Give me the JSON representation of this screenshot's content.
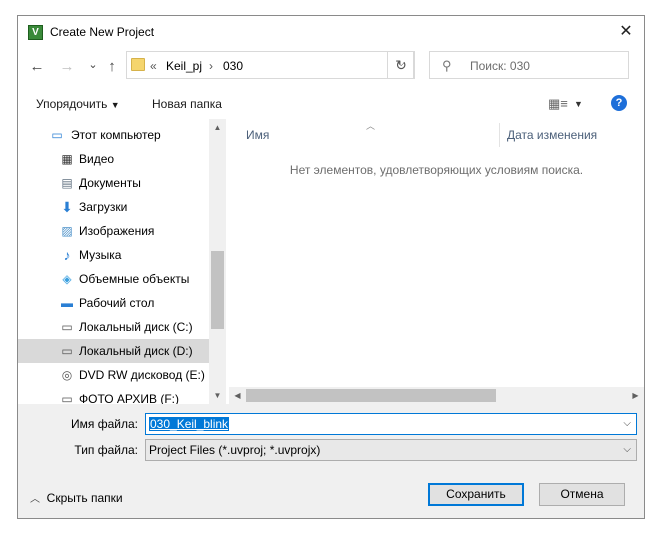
{
  "window": {
    "title": "Create New Project",
    "app_icon": "keil-uvision-icon"
  },
  "navigation": {
    "back_icon": "←",
    "forward_icon": "→",
    "recent_icon": "⌄",
    "up_icon": "↑",
    "address_prefix": "«",
    "path": [
      "Keil_pj",
      "030"
    ],
    "path_separator": "›",
    "refresh_icon": "↻",
    "search_placeholder": "Поиск: 030"
  },
  "toolbar": {
    "organize_label": "Упорядочить",
    "new_folder_label": "Новая папка",
    "view_icon": "▦≡",
    "help_icon": "?"
  },
  "sidebar": {
    "items": [
      {
        "label": "Этот компьютер",
        "icon": "computer-icon"
      },
      {
        "label": "Видео",
        "icon": "video-icon"
      },
      {
        "label": "Документы",
        "icon": "documents-icon"
      },
      {
        "label": "Загрузки",
        "icon": "downloads-icon"
      },
      {
        "label": "Изображения",
        "icon": "pictures-icon"
      },
      {
        "label": "Музыка",
        "icon": "music-icon"
      },
      {
        "label": "Объемные объекты",
        "icon": "3d-objects-icon"
      },
      {
        "label": "Рабочий стол",
        "icon": "desktop-icon"
      },
      {
        "label": "Локальный диск (C:)",
        "icon": "system-drive-icon"
      },
      {
        "label": "Локальный диск (D:)",
        "icon": "drive-icon"
      },
      {
        "label": "DVD RW дисковод (E:)",
        "icon": "dvd-drive-icon"
      },
      {
        "label": "ФОТО АРХИВ (F:)",
        "icon": "drive-icon"
      }
    ]
  },
  "file_list": {
    "columns": [
      "Имя",
      "Дата изменения"
    ],
    "empty_message": "Нет элементов, удовлетворяющих условиям поиска."
  },
  "form": {
    "filename_label": "Имя файла:",
    "filename_value": "030_Keil_blink",
    "filetype_label": "Тип файла:",
    "filetype_value": "Project Files (*.uvproj; *.uvprojx)",
    "hide_folders_label": "Скрыть папки",
    "save_label": "Сохранить",
    "cancel_label": "Отмена"
  },
  "colors": {
    "accent": "#0078d7",
    "selection": "#cce4f7",
    "panel": "#f0f0f0"
  }
}
